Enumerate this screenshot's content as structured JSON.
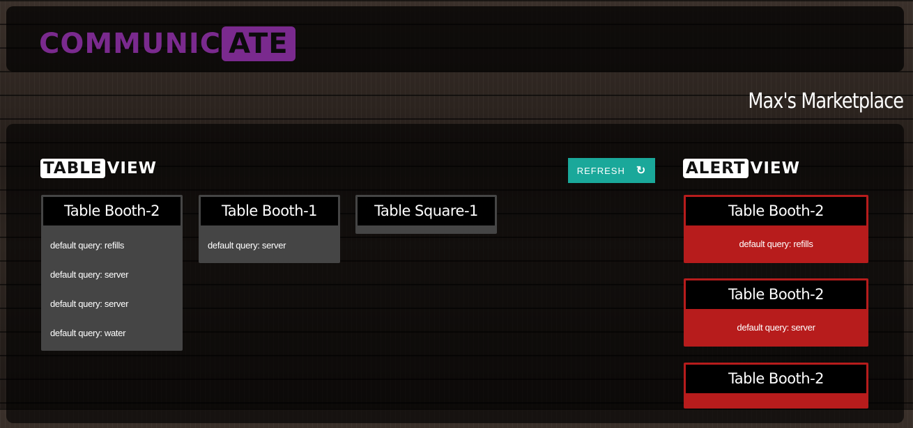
{
  "header": {
    "logo_part1": "COMMUNIC",
    "logo_part2": "ATE",
    "brand_color": "#7a2a8e",
    "venue_name": "Max's Marketplace"
  },
  "table_view": {
    "title_boxed": "TABLE",
    "title_plain": "VIEW",
    "refresh_label": "REFRESH",
    "refresh_icon": "refresh-icon",
    "accent_color": "#1aa89a",
    "tables": [
      {
        "name": "Table Booth-2",
        "queries": [
          "default query: refills",
          "default query: server",
          "default query: server",
          "default query: water"
        ]
      },
      {
        "name": "Table Booth-1",
        "queries": [
          "default query: server"
        ]
      },
      {
        "name": "Table Square-1",
        "queries": []
      }
    ]
  },
  "alert_view": {
    "title_boxed": "ALERT",
    "title_plain": "VIEW",
    "alert_color": "#b71c1c",
    "alerts": [
      {
        "name": "Table Booth-2",
        "query": "default query: refills"
      },
      {
        "name": "Table Booth-2",
        "query": "default query: server"
      },
      {
        "name": "Table Booth-2",
        "query": ""
      }
    ]
  }
}
